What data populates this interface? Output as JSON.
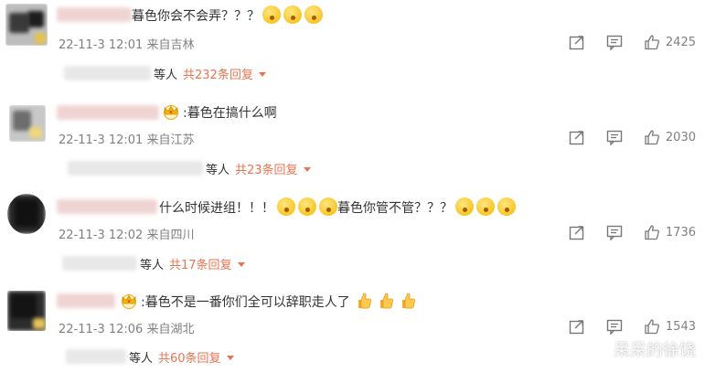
{
  "comments": [
    {
      "text": "暮色你会不会弄？？？",
      "timestamp": "22-11-3 12:01",
      "location": "来自吉林",
      "likes": "2425",
      "replies_prefix": "等人",
      "replies_label": "共232条回复"
    },
    {
      "text": ":暮色在搞什么啊",
      "timestamp": "22-11-3 12:01",
      "location": "来自江苏",
      "likes": "2030",
      "replies_prefix": "等人",
      "replies_label": "共23条回复"
    },
    {
      "text_a": "什么时候进组！！！",
      "text_b": "暮色你管不管？？？",
      "timestamp": "22-11-3 12:02",
      "location": "来自四川",
      "likes": "1736",
      "replies_prefix": "等人",
      "replies_label": "共17条回复"
    },
    {
      "text": ":暮色不是一番你们全可以辞职走人了",
      "timestamp": "22-11-3 12:06",
      "location": "来自湖北",
      "likes": "1543",
      "replies_prefix": "等人",
      "replies_label": "共60条回复"
    }
  ],
  "icons": {
    "share": "share-icon",
    "comment": "comment-icon",
    "like": "like-icon",
    "emoji": "surprised-emoji-icon",
    "thumbs": "thumbs-up-emoji-icon",
    "crown": "crown-badge-icon"
  },
  "colors": {
    "accent": "#eb7350",
    "meta": "#808080",
    "text": "#333333"
  },
  "watermark": "呆呆的徐饶"
}
